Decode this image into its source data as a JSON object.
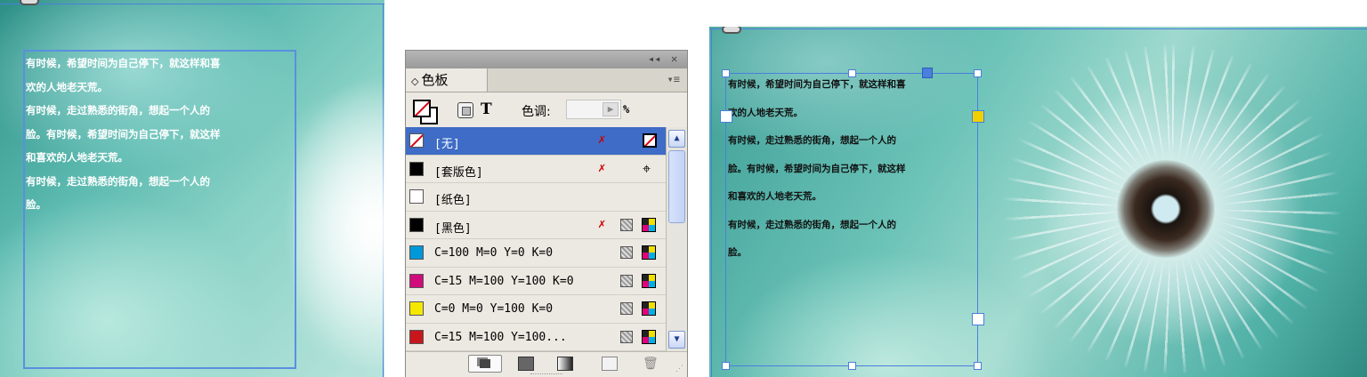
{
  "text_lines": [
    "有时候，希望时间为自己停下，就这样和喜",
    "欢的人地老天荒。",
    "有时候，走过熟悉的街角，想起一个人的",
    "脸。有时候，希望时间为自己停下，就这样",
    "和喜欢的人地老天荒。",
    "有时候，走过熟悉的街角，想起一个人的",
    "脸。"
  ],
  "swatches_panel": {
    "tab_arrows": "◇",
    "tab_title": "色板",
    "collapse_glyph": "◂◂",
    "close_glyph": "✕",
    "menu_glyph": "▾≡",
    "text_button_label": "T",
    "tint_label": "色调:",
    "tint_value": "",
    "tint_arrow": "▶",
    "tint_unit": "%",
    "scroll_up": "▲",
    "scroll_down": "▼",
    "trash_glyph": "🗑",
    "grip_glyph": "⋰",
    "rows": [
      {
        "name": "[无]",
        "color": "none"
      },
      {
        "name": "[套版色]",
        "color": "#000000"
      },
      {
        "name": "[纸色]",
        "color": "#ffffff"
      },
      {
        "name": "[黑色]",
        "color": "#000000"
      },
      {
        "name": "C=100 M=0 Y=0 K=0",
        "color": "#0098d8"
      },
      {
        "name": "C=15 M=100 Y=100 K=0",
        "color": "#d00c7c"
      },
      {
        "name": "C=0 M=0 Y=100 K=0",
        "color": "#f5e800"
      },
      {
        "name": "C=15 M=100 Y=100...",
        "color": "#c8161d"
      }
    ],
    "icons": {
      "noedit": "✗",
      "registration": "⌖"
    }
  },
  "colors": {
    "selection_blue": "#3e6cc6",
    "frame_blue": "#4a7fdc",
    "outport_yellow": "#f0d000"
  }
}
